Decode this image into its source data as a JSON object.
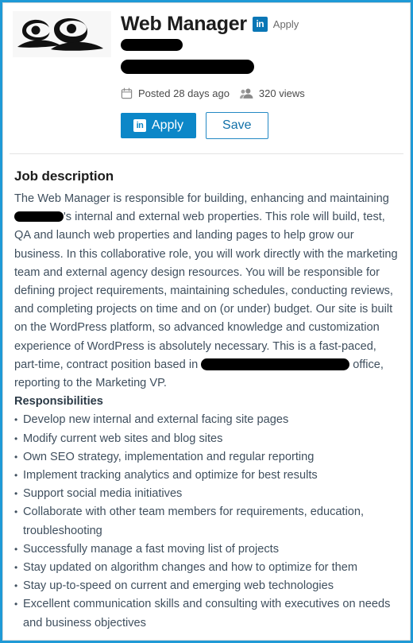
{
  "theme": {
    "frame_border_color": "#1f9ad6",
    "card_border_color": "#d9d9d9",
    "accent_blue": "#0c87c8",
    "linkedin_blue": "#0a77b6",
    "save_border_color": "#2489c4",
    "body_text_color": "#3f4f5e",
    "heading_color": "#1d1d1d",
    "redaction_color": "#000000"
  },
  "header": {
    "logo_alt": "company-logo",
    "job_title": "Web Manager",
    "linkedin_badge_label": "in",
    "linkedin_apply_label": "Apply",
    "company_name": "",
    "company_name_redacted": true,
    "location": "",
    "location_redacted": true,
    "meta": [
      {
        "icon": "calendar-icon",
        "label": "Posted 28 days ago"
      },
      {
        "icon": "people-icon",
        "label": "320 views"
      }
    ],
    "buttons": {
      "apply_label": "Apply",
      "apply_badge_label": "in",
      "save_label": "Save"
    }
  },
  "description": {
    "section_title": "Job description",
    "paragraph_part1": "The Web Manager is responsible for building, enhancing and maintaining ",
    "paragraph_part2": "'s internal and external web properties. This role will build, test, QA and launch web properties and landing pages to help grow our business. In this collaborative role, you will work directly with the marketing team and external agency design resources. You will be responsible for defining project requirements, maintaining schedules, conducting reviews, and completing projects on time and on (or under) budget. Our site is built on the WordPress platform, so advanced knowledge and customization experience of WordPress is absolutely necessary. This is a fast-paced, part-time, contract position based in ",
    "paragraph_part3": " office, reporting to the Marketing VP.",
    "responsibilities_heading": "Responsibilities",
    "responsibilities": [
      "Develop new internal and external facing site pages",
      "Modify current web sites and blog sites",
      "Own SEO strategy, implementation and regular reporting",
      "Implement tracking analytics and optimize for best results",
      "Support social media initiatives",
      "Collaborate with other team members for requirements, education, troubleshooting",
      "Successfully manage a fast moving list of projects",
      "Stay updated on algorithm changes and how to optimize for them",
      "Stay up-to-speed on current and emerging web technologies",
      "Excellent communication skills and consulting with executives on needs and business objectives"
    ]
  }
}
